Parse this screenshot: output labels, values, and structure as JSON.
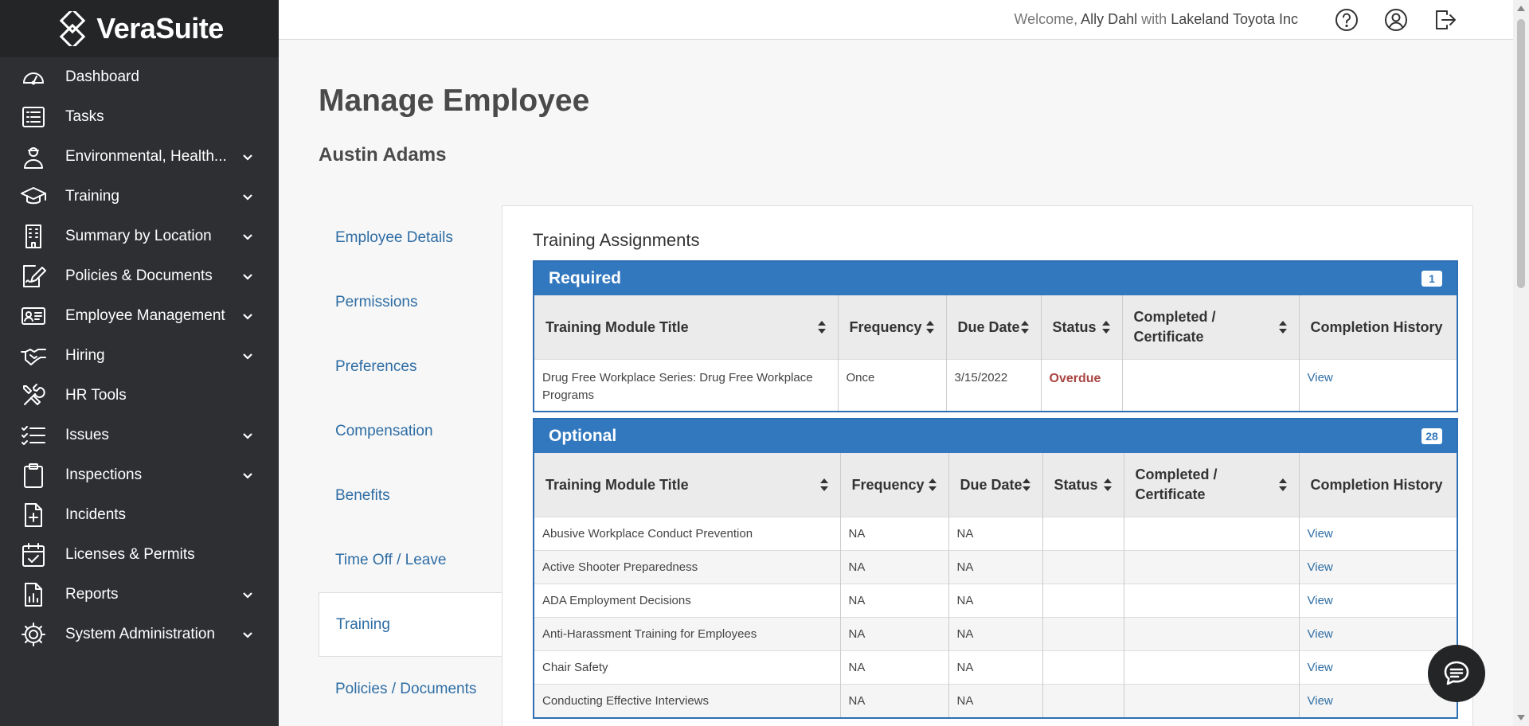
{
  "brand": {
    "name": "VeraSuite"
  },
  "topbar": {
    "welcome_prefix": "Welcome,",
    "user": "Ally Dahl",
    "with": "with",
    "company": "Lakeland Toyota Inc"
  },
  "sidebar": {
    "items": [
      {
        "label": "Dashboard",
        "icon": "gauge-icon",
        "expandable": false
      },
      {
        "label": "Tasks",
        "icon": "list-icon",
        "expandable": false
      },
      {
        "label": "Environmental, Health...",
        "icon": "worker-icon",
        "expandable": true
      },
      {
        "label": "Training",
        "icon": "graduation-cap-icon",
        "expandable": true
      },
      {
        "label": "Summary by Location",
        "icon": "building-icon",
        "expandable": true
      },
      {
        "label": "Policies & Documents",
        "icon": "document-edit-icon",
        "expandable": true
      },
      {
        "label": "Employee Management",
        "icon": "id-card-icon",
        "expandable": true
      },
      {
        "label": "Hiring",
        "icon": "handshake-icon",
        "expandable": true
      },
      {
        "label": "HR Tools",
        "icon": "tools-icon",
        "expandable": false
      },
      {
        "label": "Issues",
        "icon": "checklist-icon",
        "expandable": true
      },
      {
        "label": "Inspections",
        "icon": "clipboard-icon",
        "expandable": true
      },
      {
        "label": "Incidents",
        "icon": "file-plus-icon",
        "expandable": false
      },
      {
        "label": "Licenses & Permits",
        "icon": "calendar-check-icon",
        "expandable": false
      },
      {
        "label": "Reports",
        "icon": "report-icon",
        "expandable": true
      },
      {
        "label": "System Administration",
        "icon": "gear-icon",
        "expandable": true
      }
    ]
  },
  "page": {
    "title": "Manage Employee",
    "employee_name": "Austin Adams"
  },
  "tabs": [
    {
      "label": "Employee Details",
      "active": false
    },
    {
      "label": "Permissions",
      "active": false
    },
    {
      "label": "Preferences",
      "active": false
    },
    {
      "label": "Compensation",
      "active": false
    },
    {
      "label": "Benefits",
      "active": false
    },
    {
      "label": "Time Off / Leave",
      "active": false
    },
    {
      "label": "Training",
      "active": true
    },
    {
      "label": "Policies / Documents",
      "active": false
    }
  ],
  "training": {
    "section_title": "Training Assignments",
    "columns": [
      "Training Module Title",
      "Frequency",
      "Due Date",
      "Status",
      "Completed / Certificate",
      "Completion History"
    ],
    "required": {
      "title": "Required",
      "count": "1",
      "rows": [
        {
          "title": "Drug Free Workplace Series: Drug Free Workplace Programs",
          "frequency": "Once",
          "due": "3/15/2022",
          "status": "Overdue",
          "completed": "",
          "history": "View"
        }
      ]
    },
    "optional": {
      "title": "Optional",
      "count": "28",
      "rows": [
        {
          "title": "Abusive Workplace Conduct Prevention",
          "frequency": "NA",
          "due": "NA",
          "status": "",
          "completed": "",
          "history": "View"
        },
        {
          "title": "Active Shooter Preparedness",
          "frequency": "NA",
          "due": "NA",
          "status": "",
          "completed": "",
          "history": "View"
        },
        {
          "title": "ADA Employment Decisions",
          "frequency": "NA",
          "due": "NA",
          "status": "",
          "completed": "",
          "history": "View"
        },
        {
          "title": "Anti-Harassment Training for Employees",
          "frequency": "NA",
          "due": "NA",
          "status": "",
          "completed": "",
          "history": "View"
        },
        {
          "title": "Chair Safety",
          "frequency": "NA",
          "due": "NA",
          "status": "",
          "completed": "",
          "history": "View"
        },
        {
          "title": "Conducting Effective Interviews",
          "frequency": "NA",
          "due": "NA",
          "status": "",
          "completed": "",
          "history": "View"
        }
      ]
    }
  },
  "colors": {
    "sidebar_bg": "#2d2f33",
    "table_header_blue": "#3178bf",
    "link_blue": "#2e6da4",
    "overdue_red": "#a94442"
  }
}
